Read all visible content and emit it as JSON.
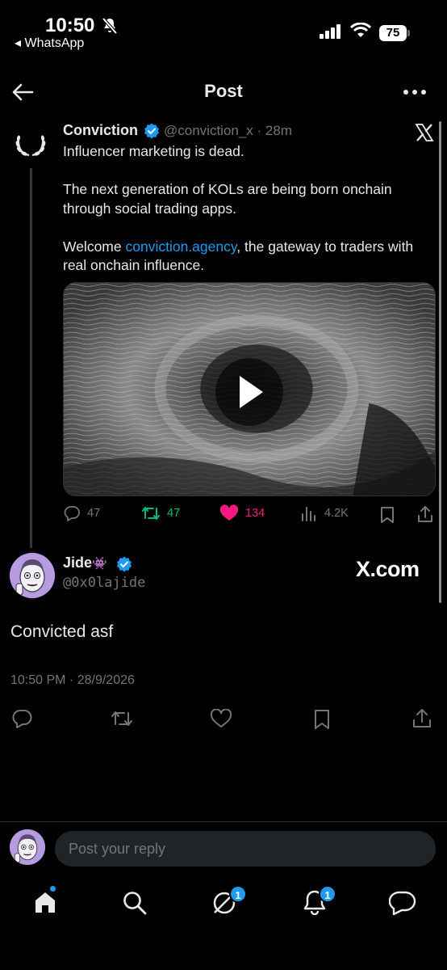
{
  "status_bar": {
    "time": "10:50",
    "back_app": "◂ WhatsApp",
    "battery": "75"
  },
  "header": {
    "title": "Post"
  },
  "quoted_post": {
    "name": "Conviction",
    "handle_time": "@conviction_x · 28m",
    "text_line1": "Influencer marketing is dead.",
    "text_line2": "The next generation of KOLs are being born onchain through social trading apps.",
    "text_line3_pre": "Welcome ",
    "text_line3_link": "conviction.agency",
    "text_line3_post": ", the gateway to traders with real onchain influence.",
    "replies": "47",
    "reposts": "47",
    "likes": "134",
    "views": "4.2K"
  },
  "main_post": {
    "name": "Jide",
    "name_emoji": "👾",
    "handle": "@0x0lajide",
    "watermark": "X.com",
    "body": "Convicted asf",
    "timestamp": "10:50 PM · 28/9/2026"
  },
  "reply": {
    "placeholder": "Post your reply"
  },
  "bottom_nav": {
    "grok_badge": "1",
    "notifications_badge": "1"
  },
  "colors": {
    "accent": "#1d9bf0",
    "repost": "#00ba7c",
    "like": "#f91880",
    "muted": "#71767b"
  }
}
